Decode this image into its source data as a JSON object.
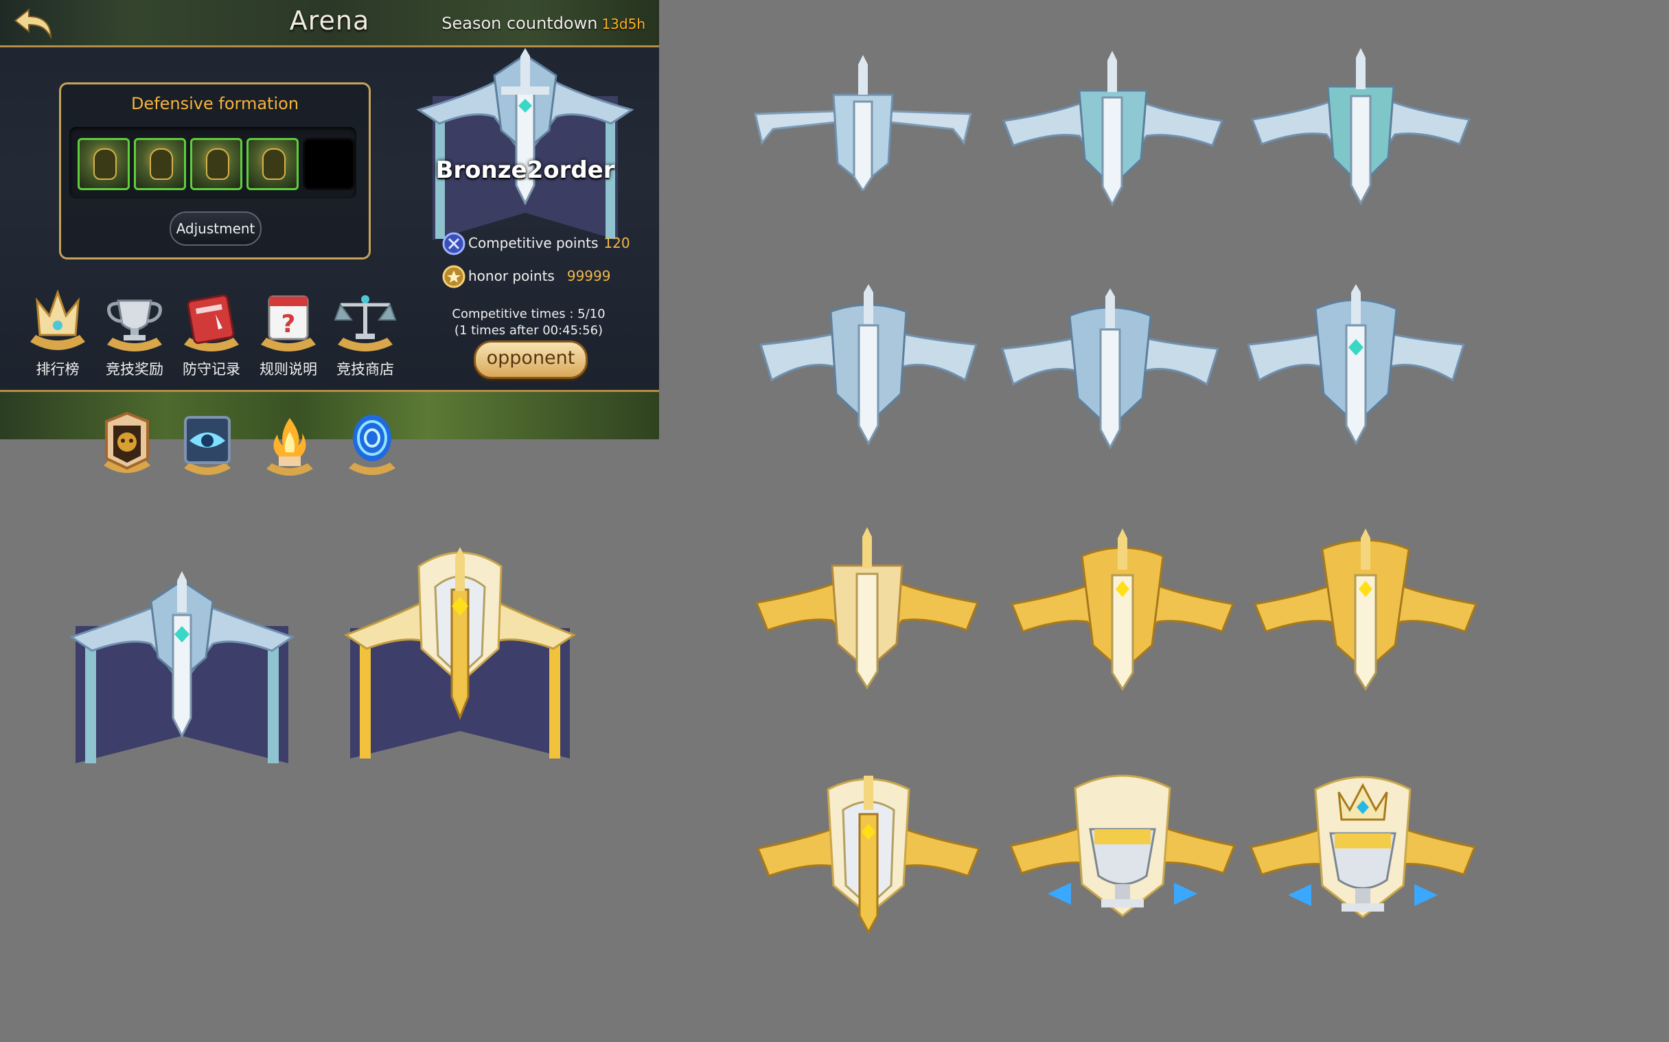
{
  "header": {
    "title": "Arena",
    "season_label": "Season countdown",
    "season_value": "13d5h"
  },
  "defense": {
    "title": "Defensive formation",
    "adjust_label": "Adjustment",
    "filled_slots": 4,
    "total_slots": 5
  },
  "menu": [
    {
      "label": "排行榜",
      "icon": "crown-icon"
    },
    {
      "label": "竞技奖励",
      "icon": "trophy-icon"
    },
    {
      "label": "防守记录",
      "icon": "record-book-icon"
    },
    {
      "label": "规则说明",
      "icon": "rules-calendar-icon"
    },
    {
      "label": "竞技商店",
      "icon": "scale-shop-icon"
    }
  ],
  "rank": {
    "name": "Bronze2order",
    "competitive_points_label": "Competitive points",
    "competitive_points_value": "120",
    "honor_points_label": "honor points",
    "honor_points_value": "99999",
    "competitive_times": "Competitive times : 5/10",
    "times_after": "(1 times after 00:45:56)",
    "opponent_label": "opponent"
  },
  "extra_icons": [
    "skull-shield-icon",
    "eye-icon",
    "flame-icon",
    "portal-icon"
  ],
  "colors": {
    "accent_gold": "#f7b43a",
    "slot_border": "#5ecf3b",
    "background": "#777777"
  }
}
